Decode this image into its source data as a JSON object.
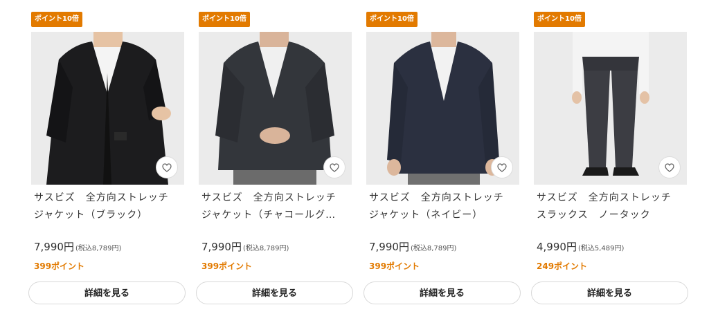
{
  "products": [
    {
      "badge": "ポイント10倍",
      "name_line1": "サスビズ　全方向ストレッチ",
      "name_line2": "ジャケット（ブラック）",
      "price": "7,990円",
      "price_tax": "(税込8,789円)",
      "points": "399ポイント",
      "detail_label": "詳細を見る",
      "image": "black-jacket-photo",
      "colors": {
        "garment": "#1c1c1e",
        "bottom": "#2a2a2a"
      }
    },
    {
      "badge": "ポイント10倍",
      "name_line1": "サスビズ　全方向ストレッチ",
      "name_line2": "ジャケット（チャコールグ…",
      "price": "7,990円",
      "price_tax": "(税込8,789円)",
      "points": "399ポイント",
      "detail_label": "詳細を見る",
      "image": "charcoal-jacket-photo",
      "colors": {
        "garment": "#33363b",
        "bottom": "#6b6b6b"
      }
    },
    {
      "badge": "ポイント10倍",
      "name_line1": "サスビズ　全方向ストレッチ",
      "name_line2": "ジャケット（ネイビー）",
      "price": "7,990円",
      "price_tax": "(税込8,789円)",
      "points": "399ポイント",
      "detail_label": "詳細を見る",
      "image": "navy-jacket-photo",
      "colors": {
        "garment": "#2b3040",
        "bottom": "#707070"
      }
    },
    {
      "badge": "ポイント10倍",
      "name_line1": "サスビズ　全方向ストレッチ",
      "name_line2": "スラックス　ノータック",
      "price": "4,990円",
      "price_tax": "(税込5,489円)",
      "points": "249ポイント",
      "detail_label": "詳細を見る",
      "image": "charcoal-slacks-photo",
      "colors": {
        "garment": "#3c3d43",
        "bottom": "#1a1a1a"
      }
    }
  ],
  "icons": {
    "favorite": "heart-outline-icon"
  },
  "colors": {
    "accent": "#e27a00",
    "text": "#333333",
    "image_bg": "#ebebeb"
  }
}
